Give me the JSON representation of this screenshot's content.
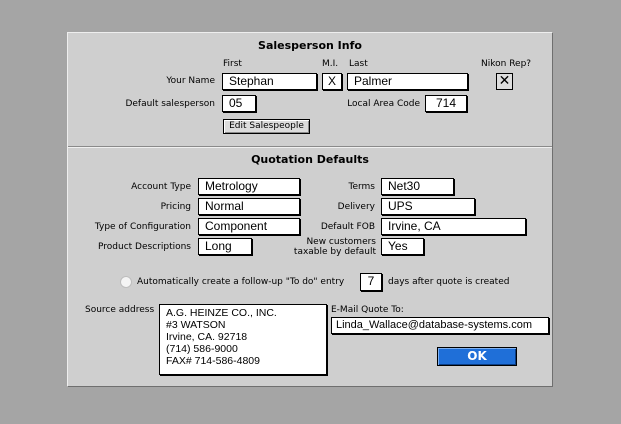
{
  "salesperson": {
    "title": "Salesperson Info",
    "first_header": "First",
    "mi_header": "M.I.",
    "last_header": "Last",
    "nikon_header": "Nikon Rep?",
    "your_name_label": "Your Name",
    "first_value": "Stephan",
    "mi_value": "X",
    "last_value": "Palmer",
    "nikon_checked_mark": "✕",
    "default_salesperson_label": "Default salesperson",
    "default_salesperson_value": "05",
    "area_code_label": "Local Area Code",
    "area_code_value": "714",
    "edit_button": "Edit Salespeople"
  },
  "quotation": {
    "title": "Quotation Defaults",
    "account_type_label": "Account Type",
    "account_type_value": "Metrology",
    "pricing_label": "Pricing",
    "pricing_value": "Normal",
    "config_label": "Type of Configuration",
    "config_value": "Component",
    "product_desc_label": "Product Descriptions",
    "product_desc_value": "Long",
    "terms_label": "Terms",
    "terms_value": "Net30",
    "delivery_label": "Delivery",
    "delivery_value": "UPS",
    "fob_label": "Default FOB",
    "fob_value": "Irvine, CA",
    "taxable_label_1": "New customers",
    "taxable_label_2": "taxable by default",
    "taxable_value": "Yes",
    "followup_text_before": "Automatically create a follow-up \"To do\" entry",
    "followup_days": "7",
    "followup_text_after": "days after quote is created",
    "source_address_label": "Source address",
    "source_address_value": "A.G. HEINZE CO., INC.\n#3 WATSON\nIrvine, CA. 92718\n(714) 586-9000\nFAX# 714-586-4809",
    "email_label": "E-Mail Quote To:",
    "email_value": "Linda_Wallace@database-systems.com",
    "ok_button": "OK"
  }
}
